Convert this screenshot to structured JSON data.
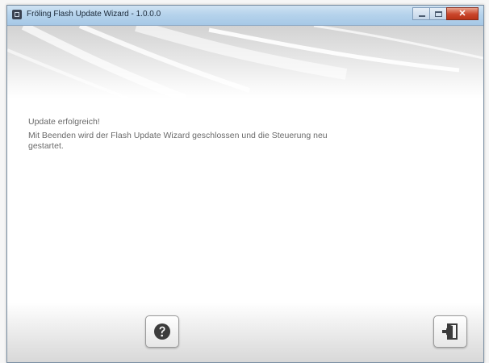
{
  "window": {
    "title": "Fröling Flash Update Wizard - 1.0.0.0"
  },
  "message": {
    "line1": "Update erfolgreich!",
    "line2": "Mit Beenden wird der Flash Update Wizard geschlossen und die Steuerung neu gestartet."
  },
  "icons": {
    "help": "help-question-icon",
    "exit": "exit-door-icon"
  },
  "colors": {
    "titlebar": "#b6d3ec",
    "text": "#6a6a6a",
    "close_button": "#c9452a"
  }
}
